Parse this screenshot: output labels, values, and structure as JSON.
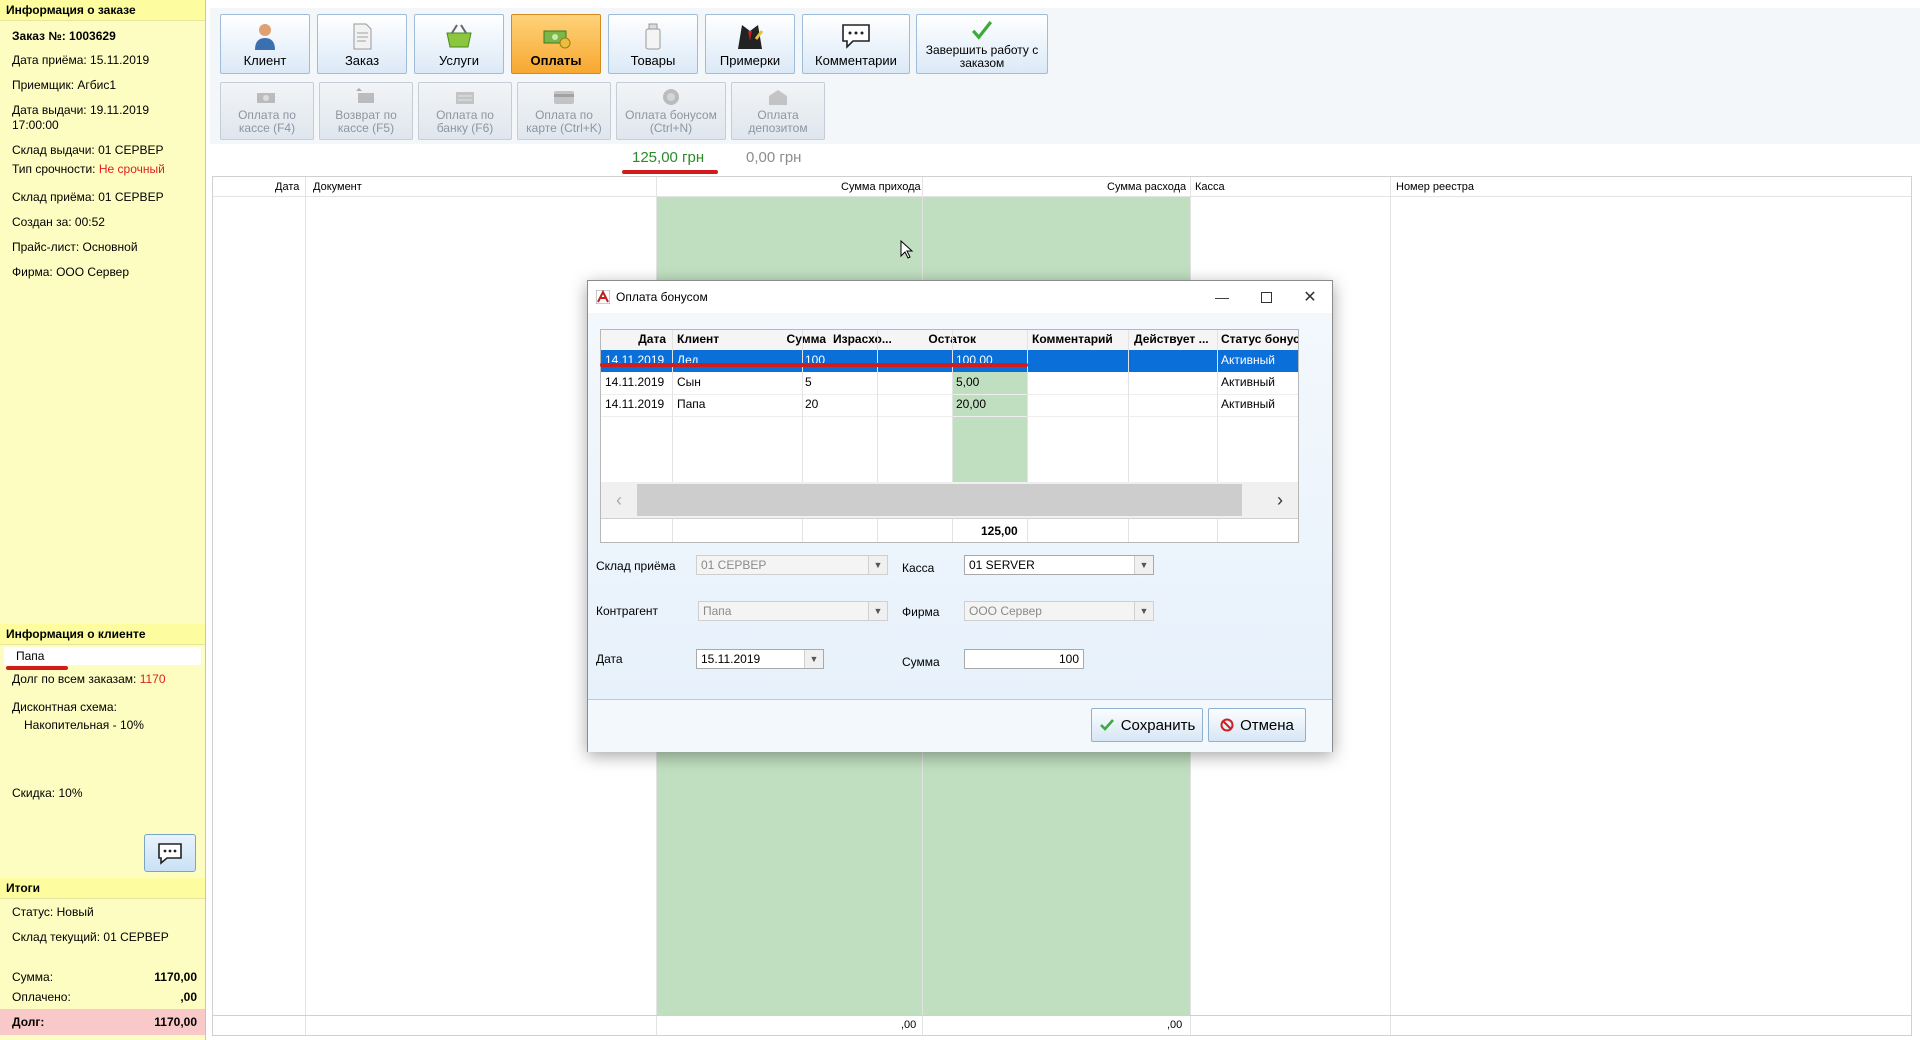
{
  "order_info": {
    "title": "Информация о заказе",
    "order_no": "Заказ №: 1003629",
    "accept_date": "Дата приёма: 15.11.2019",
    "receiver": "Приемщик: Агбис1",
    "issue_date_line1": "Дата выдачи: 19.11.2019",
    "issue_date_line2": "17:00:00",
    "issue_warehouse": "Склад выдачи: 01 СЕРВЕР",
    "urgency_label": "Тип срочности: ",
    "urgency_value": "Не срочный",
    "accept_warehouse": "Склад приёма: 01 СЕРВЕР",
    "created": "Создан за: 00:52",
    "pricelist": "Прайс-лист: Основной",
    "firm": "Фирма: ООО Сервер"
  },
  "client_info": {
    "title": "Информация о клиенте",
    "name": "Папа",
    "debt_label": "Долг по всем заказам: ",
    "debt_value": "1170",
    "discount_scheme_label": "Дисконтная схема:",
    "discount_scheme_value": "Накопительная - 10%",
    "discount": "Скидка: 10%"
  },
  "totals": {
    "title": "Итоги",
    "status": "Статус: Новый",
    "current_warehouse": "Склад текущий: 01 СЕРВЕР",
    "sum_label": "Сумма:",
    "sum_value": "1170,00",
    "paid_label": "Оплачено:",
    "paid_value": ",00",
    "debt_label": "Долг:",
    "debt_value": "1170,00"
  },
  "toolbar": {
    "client": "Клиент",
    "order": "Заказ",
    "services": "Услуги",
    "payments": "Оплаты",
    "goods": "Товары",
    "fittings": "Примерки",
    "comments": "Комментарии",
    "finish_line1": "Завершить работу с",
    "finish_line2": "заказом"
  },
  "payment_toolbar": {
    "cash_1": "Оплата по",
    "cash_2": "кассе (F4)",
    "refund_1": "Возврат по",
    "refund_2": "кассе (F5)",
    "bank_1": "Оплата по",
    "bank_2": "банку (F6)",
    "card_1": "Оплата по",
    "card_2": "карте (Ctrl+K)",
    "bonus_1": "Оплата бонусом",
    "bonus_2": "(Ctrl+N)",
    "deposit_1": "Оплата",
    "deposit_2": "депозитом"
  },
  "amounts": {
    "green": "125,00 грн",
    "gray": "0,00 грн"
  },
  "grid": {
    "headers": {
      "date": "Дата",
      "document": "Документ",
      "income": "Сумма прихода",
      "expense": "Сумма расхода",
      "cashbox": "Касса",
      "registry": "Номер реестра"
    },
    "footer_income": ",00",
    "footer_expense": ",00"
  },
  "dialog": {
    "title": "Оплата бонусом",
    "columns": {
      "date": "Дата",
      "client": "Клиент",
      "sum": "Сумма",
      "spent": "Израсхо...",
      "rest": "Остаток",
      "comment": "Комментарий",
      "valid": "Действует ...",
      "status": "Статус бонуса"
    },
    "rows": [
      {
        "date": "14.11.2019",
        "client": "Дед",
        "sum": "100",
        "spent": "",
        "rest": "100,00",
        "comment": "",
        "valid": "",
        "status": "Активный"
      },
      {
        "date": "14.11.2019",
        "client": "Сын",
        "sum": "5",
        "spent": "",
        "rest": "5,00",
        "comment": "",
        "valid": "",
        "status": "Активный"
      },
      {
        "date": "14.11.2019",
        "client": "Папа",
        "sum": "20",
        "spent": "",
        "rest": "20,00",
        "comment": "",
        "valid": "",
        "status": "Активный"
      }
    ],
    "total_rest": "125,00",
    "form": {
      "accept_warehouse_label": "Склад приёма",
      "accept_warehouse_value": "01 СЕРВЕР",
      "cashbox_label": "Касса",
      "cashbox_value": "01 SERVER",
      "contractor_label": "Контрагент",
      "contractor_value": "Папа",
      "firm_label": "Фирма",
      "firm_value": "ООО Сервер",
      "date_label": "Дата",
      "date_value": "15.11.2019",
      "sum_label": "Сумма",
      "sum_value": "100"
    },
    "save": "Сохранить",
    "cancel": "Отмена"
  },
  "colors": {
    "green_amount": "#2a8a2a",
    "active_btn": "#f7a830",
    "selected_row": "#0a6fd8",
    "grid_green": "#c0dfc0",
    "red": "#e02020"
  }
}
